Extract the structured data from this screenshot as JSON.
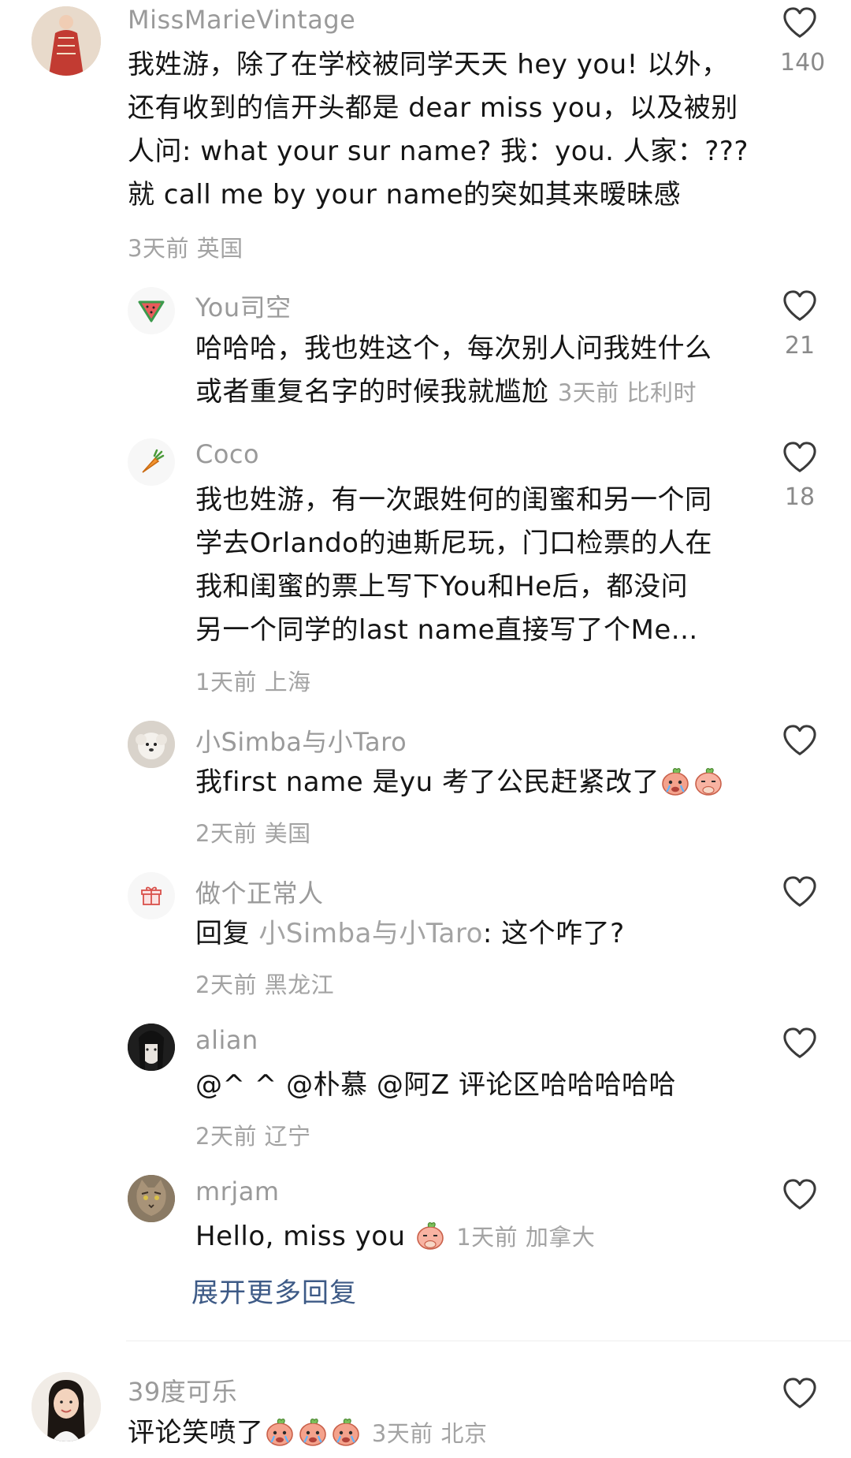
{
  "comments": [
    {
      "username": "MissMarieVintage",
      "text_lines": [
        "我姓游，除了在学校被同学天天 hey you! 以外，",
        "还有收到的信开头都是 dear miss you，以及被别",
        "人问: what your sur name? 我：you. 人家：???",
        "就 call me by your name的突如其来暧昧感"
      ],
      "meta": "3天前 英国",
      "likes": "140",
      "avatar_icon": "vintage-dress-avatar"
    },
    {
      "username": "You司空",
      "text_lines": [
        "哈哈哈，我也姓这个，每次别人问我姓什么",
        "或者重复名字的时候我就尴尬"
      ],
      "meta": "3天前 比利时",
      "likes": "21",
      "avatar_icon": "watermelon-icon"
    },
    {
      "username": "Coco",
      "text_lines": [
        "我也姓游，有一次跟姓何的闺蜜和另一个同",
        "学去Orlando的迪斯尼玩，门口检票的人在",
        "我和闺蜜的票上写下You和He后，都没问",
        "另一个同学的last name直接写了个Me..."
      ],
      "meta": "1天前 上海",
      "likes": "18",
      "avatar_icon": "carrot-icon"
    },
    {
      "username": "小Simba与小Taro",
      "text": "我first name 是yu 考了公民赶紧改了",
      "meta": "2天前 美国",
      "avatar_icon": "dog-avatar"
    },
    {
      "username": "做个正常人",
      "reply_prefix": "回复 ",
      "reply_to": "小Simba与小Taro",
      "reply_text": ": 这个咋了?",
      "meta": "2天前 黑龙江",
      "avatar_icon": "gift-icon"
    },
    {
      "username": "alian",
      "text": "@^ ^ @朴慕 @阿Z 评论区哈哈哈哈哈",
      "meta": "2天前 辽宁",
      "avatar_icon": "girl-avatar"
    },
    {
      "username": "mrjam",
      "text": "Hello, miss you ",
      "meta": "1天前 加拿大",
      "avatar_icon": "cat-avatar"
    },
    {
      "username": "39度可乐",
      "text": "评论笑喷了",
      "meta": "3天前 北京",
      "avatar_icon": "woman-avatar"
    }
  ],
  "expand_label": "展开更多回复",
  "colors": {
    "username": "#9a9a9a",
    "meta": "#a3a3a3",
    "expand": "#3d5a86",
    "heart": "#3a3a3a"
  }
}
